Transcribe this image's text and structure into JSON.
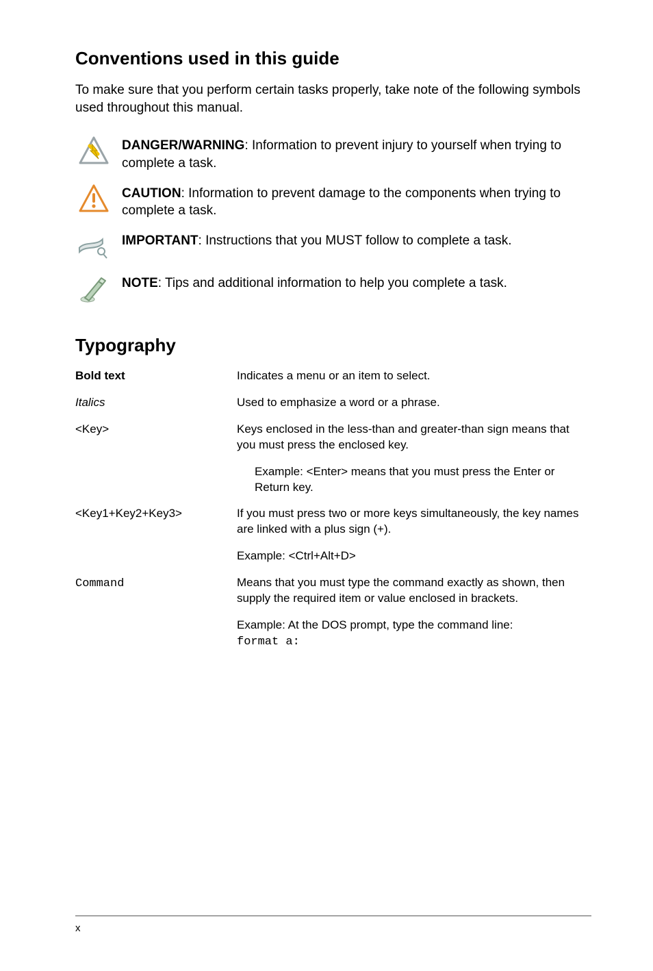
{
  "headings": {
    "conventions": "Conventions used in this guide",
    "typography": "Typography"
  },
  "intro": "To make sure that you perform certain tasks properly, take note of the following symbols used throughout this manual.",
  "admonitions": [
    {
      "icon": "danger-icon",
      "label": "DANGER/WARNING",
      "text": ": Information to prevent injury to yourself when trying to complete a task."
    },
    {
      "icon": "caution-icon",
      "label": "CAUTION",
      "text": ": Information to prevent damage to the components when trying to complete a task."
    },
    {
      "icon": "important-icon",
      "label": "IMPORTANT",
      "text": ": Instructions that you MUST follow to complete a task."
    },
    {
      "icon": "note-icon",
      "label": "NOTE",
      "text": ": Tips and additional information to help you complete a task."
    }
  ],
  "typography": {
    "rows": [
      {
        "term_html": "<b>Bold text</b>",
        "term_name": "bold-text-term",
        "desc": "Indicates a menu or an item to select."
      },
      {
        "term_html": "<i>Italics</i>",
        "term_name": "italics-term",
        "desc": "Used to emphasize a word or a phrase."
      },
      {
        "term_html": "&lt;Key&gt;",
        "term_name": "key-term",
        "desc": "Keys enclosed in the less-than and greater-than sign means that you must press the enclosed key."
      },
      {
        "term_html": "",
        "term_name": "key-example-term",
        "desc_indent": "Example: <Enter> means that you must press the Enter or Return key."
      },
      {
        "term_html": "&lt;Key1+Key2+Key3&gt;",
        "term_name": "keycombo-term",
        "desc": "If you must press two or more keys simultaneously, the key names are linked with a plus sign (+)."
      },
      {
        "term_html": "",
        "term_name": "keycombo-example-term",
        "desc": "Example: <Ctrl+Alt+D>"
      },
      {
        "term_html": "<code class=\"cmd\">Command</code>",
        "term_name": "command-term",
        "desc": "Means that you must type the command exactly as shown, then supply the required item or value enclosed in brackets."
      },
      {
        "term_html": "",
        "term_name": "command-example-term",
        "desc_html": "Example: At the DOS prompt, type the command line:<br><code class=\"cmd\">format a:</code>"
      }
    ]
  },
  "page_number": "x"
}
